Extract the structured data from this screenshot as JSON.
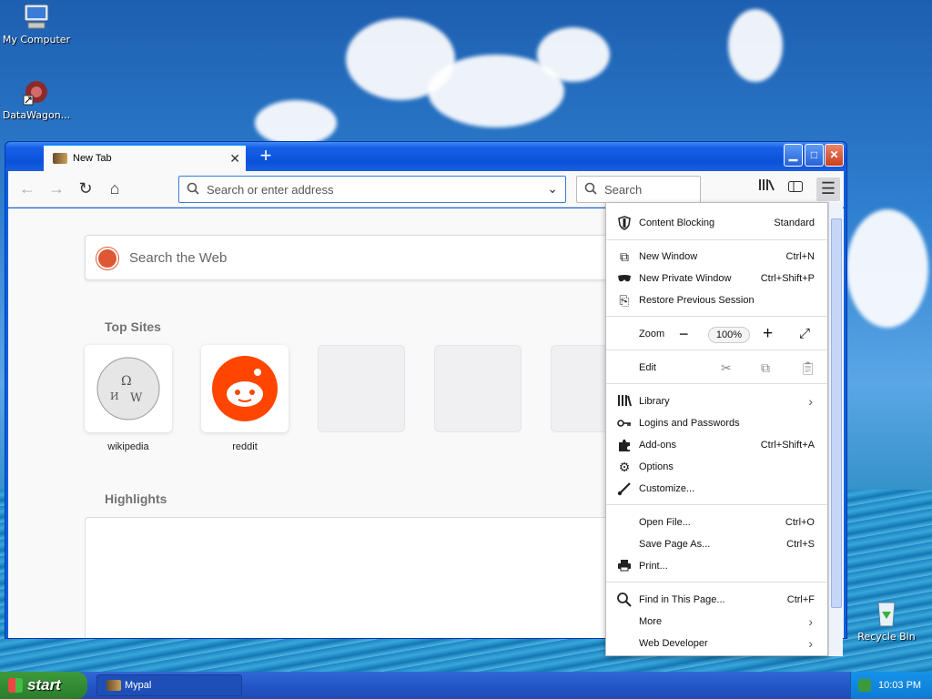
{
  "desktop": {
    "icons": [
      {
        "label": "My Computer",
        "icon": "computer-icon"
      },
      {
        "label": "DataWagon...",
        "icon": "app-shortcut-icon"
      },
      {
        "label": "Recycle Bin",
        "icon": "recycle-bin-icon"
      }
    ]
  },
  "browser": {
    "tab_title": "New Tab",
    "url_placeholder": "Search or enter address",
    "search_placeholder": "Search",
    "web_search_placeholder": "Search the Web",
    "top_sites_title": "Top Sites",
    "highlights_title": "Highlights",
    "top_sites": [
      {
        "label": "wikipedia"
      },
      {
        "label": "reddit"
      },
      {
        "label": ""
      },
      {
        "label": ""
      },
      {
        "label": ""
      }
    ]
  },
  "menu": {
    "content_blocking": {
      "label": "Content Blocking",
      "value": "Standard"
    },
    "new_window": {
      "label": "New Window",
      "shortcut": "Ctrl+N"
    },
    "new_private_window": {
      "label": "New Private Window",
      "shortcut": "Ctrl+Shift+P"
    },
    "restore_session": {
      "label": "Restore Previous Session"
    },
    "zoom": {
      "label": "Zoom",
      "value": "100%"
    },
    "edit": {
      "label": "Edit"
    },
    "library": {
      "label": "Library"
    },
    "logins": {
      "label": "Logins and Passwords"
    },
    "addons": {
      "label": "Add-ons",
      "shortcut": "Ctrl+Shift+A"
    },
    "options": {
      "label": "Options"
    },
    "customize": {
      "label": "Customize..."
    },
    "open_file": {
      "label": "Open File...",
      "shortcut": "Ctrl+O"
    },
    "save_page": {
      "label": "Save Page As...",
      "shortcut": "Ctrl+S"
    },
    "print": {
      "label": "Print..."
    },
    "find": {
      "label": "Find in This Page...",
      "shortcut": "Ctrl+F"
    },
    "more": {
      "label": "More"
    },
    "web_developer": {
      "label": "Web Developer"
    }
  },
  "taskbar": {
    "start_label": "start",
    "task_label": "Mypal",
    "clock": "10:03 PM"
  }
}
